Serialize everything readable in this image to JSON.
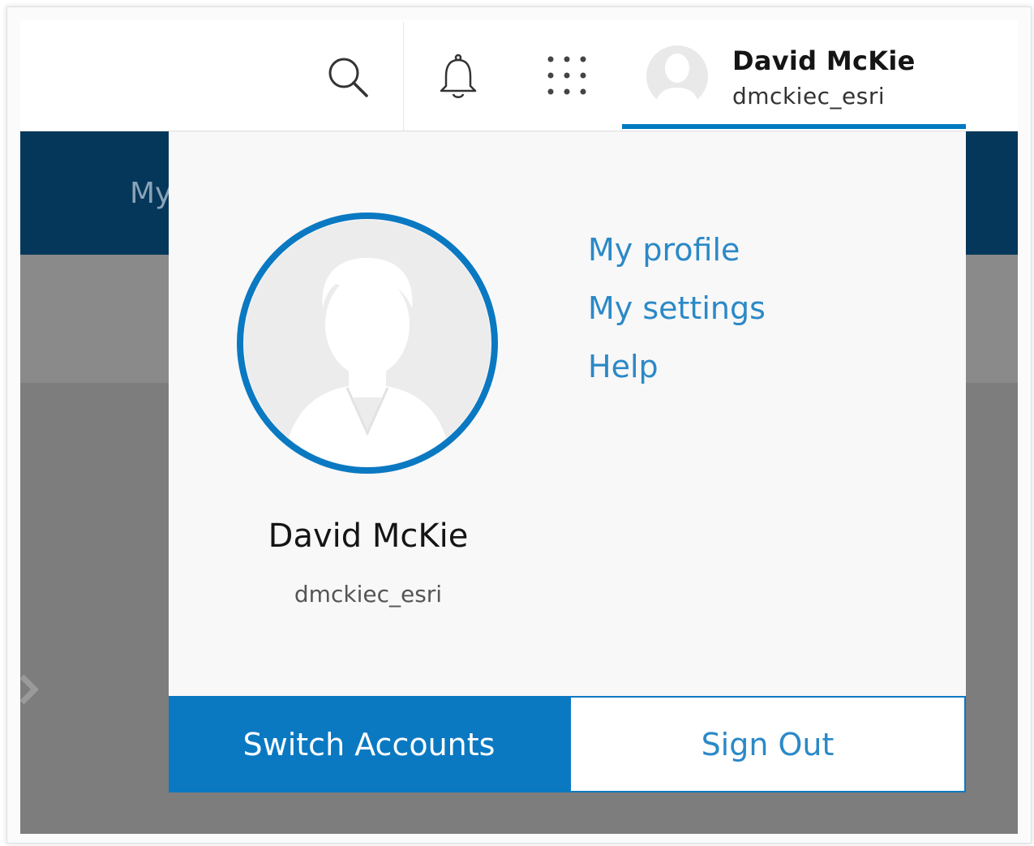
{
  "header": {
    "user_name": "David McKie",
    "username": "dmckiec_esri",
    "icons": [
      "search-icon",
      "bell-icon",
      "apps-grid-icon",
      "avatar-icon"
    ]
  },
  "background": {
    "nav_partial_text": "My"
  },
  "dropdown": {
    "user_name": "David McKie",
    "username": "dmckiec_esri",
    "menu": [
      {
        "label": "My profile"
      },
      {
        "label": "My settings"
      },
      {
        "label": "Help"
      }
    ],
    "switch_label": "Switch Accounts",
    "signout_label": "Sign Out"
  },
  "colors": {
    "accent": "#0079c1",
    "nav_bg": "#05375a",
    "link": "#2b89c7"
  }
}
